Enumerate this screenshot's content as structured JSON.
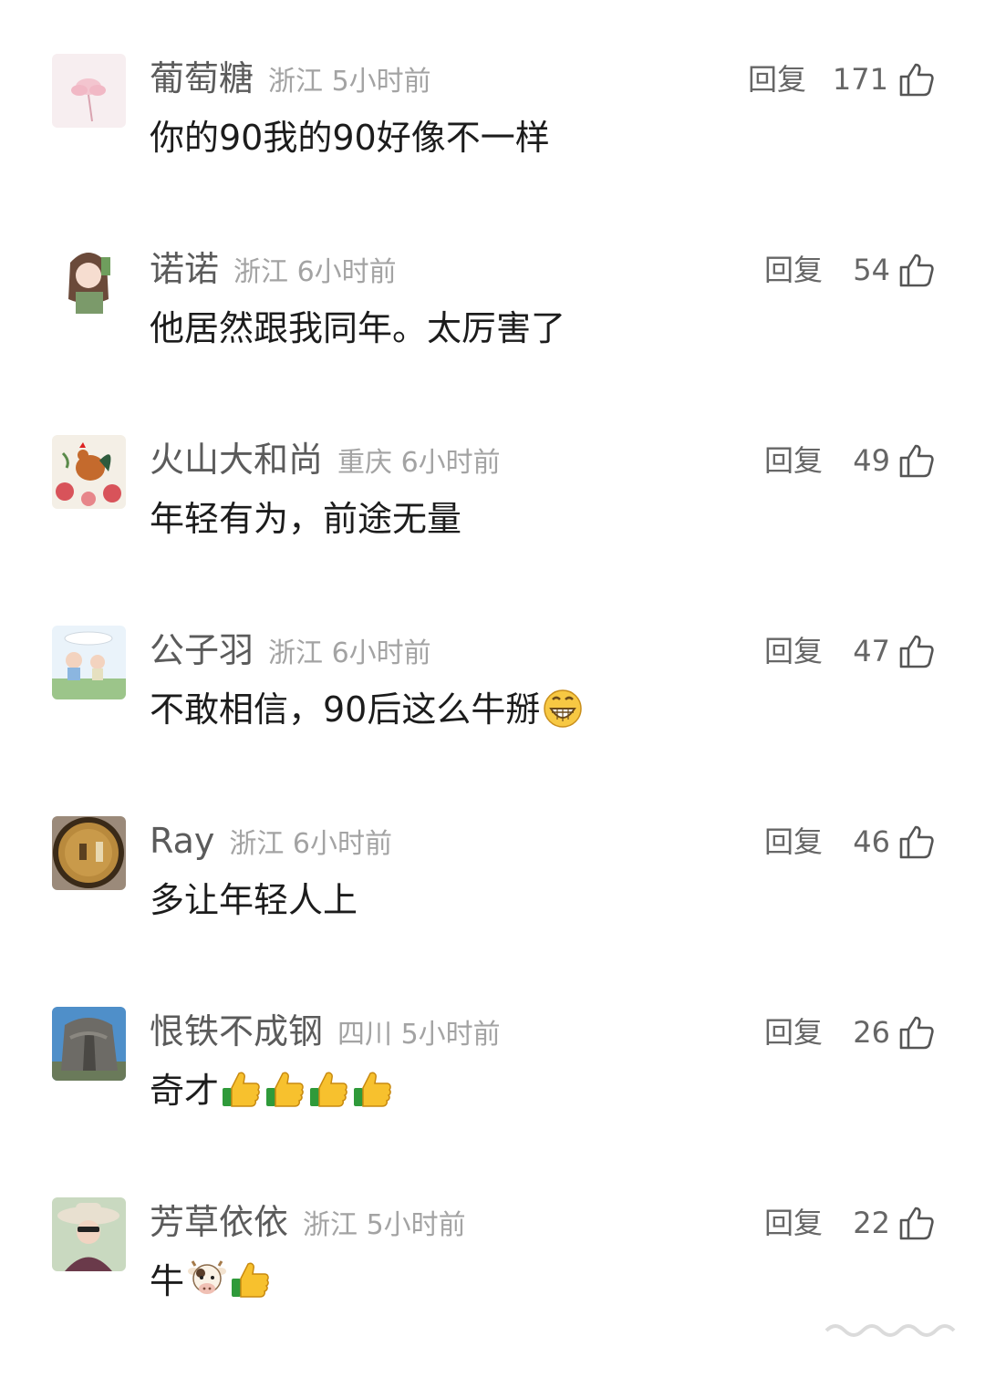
{
  "comments": [
    {
      "name": "葡萄糖",
      "region": "浙江",
      "time": "5小时前",
      "reply": "回复",
      "likes": "171",
      "text": "你的90我的90好像不一样",
      "avatar": "lotus-flower"
    },
    {
      "name": "诺诺",
      "region": "浙江",
      "time": "6小时前",
      "reply": "回复",
      "likes": "54",
      "text": "他居然跟我同年。太厉害了",
      "avatar": "cartoon-girl"
    },
    {
      "name": "火山大和尚",
      "region": "重庆",
      "time": "6小时前",
      "reply": "回复",
      "likes": "49",
      "text": "年轻有为，前途无量",
      "avatar": "rooster-flowers"
    },
    {
      "name": "公子羽",
      "region": "浙江",
      "time": "6小时前",
      "reply": "回复",
      "likes": "47",
      "text": "不敢相信，90后这么牛掰",
      "avatar": "cartoon-kid-field",
      "emojis": [
        "grin-emoji"
      ]
    },
    {
      "name": "Ray",
      "region": "浙江",
      "time": "6小时前",
      "reply": "回复",
      "likes": "46",
      "text": "多让年轻人上",
      "avatar": "golden-circle"
    },
    {
      "name": "恨铁不成钢",
      "region": "四川",
      "time": "5小时前",
      "reply": "回复",
      "likes": "26",
      "text": "奇才",
      "avatar": "elephant-sculpture",
      "emojis": [
        "thumbs-up-emoji",
        "thumbs-up-emoji",
        "thumbs-up-emoji",
        "thumbs-up-emoji"
      ]
    },
    {
      "name": "芳草依依",
      "region": "浙江",
      "time": "5小时前",
      "reply": "回复",
      "likes": "22",
      "text": "牛",
      "avatar": "woman-sun-hat",
      "emojis": [
        "cow-emoji",
        "thumbs-up-emoji"
      ]
    }
  ],
  "colors": {
    "name": "#5b5b5b",
    "meta": "#a3a3a3",
    "text": "#1c1c1c",
    "action": "#666666"
  }
}
